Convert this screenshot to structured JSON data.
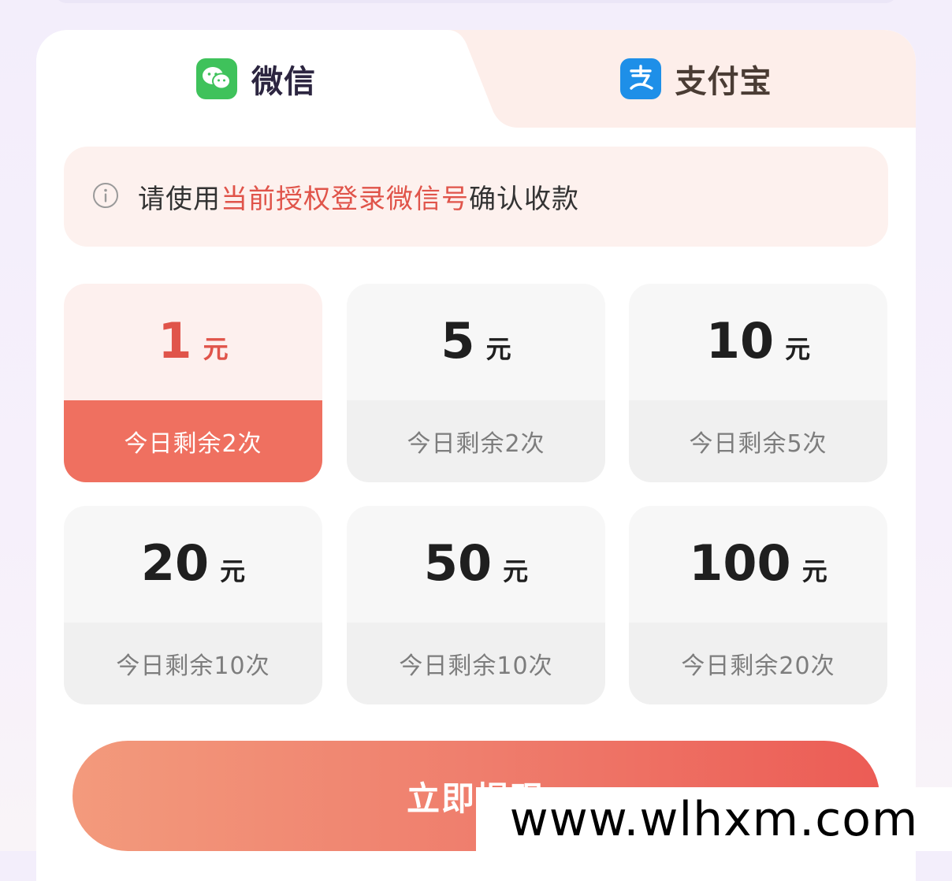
{
  "tabs": {
    "wechat": {
      "label": "微信",
      "icon": "wechat-icon",
      "active": true
    },
    "alipay": {
      "label": "支付宝",
      "icon": "alipay-icon",
      "active": false
    }
  },
  "notice": {
    "icon": "info-icon",
    "prefix": "请使用",
    "highlight": "当前授权登录微信号",
    "suffix": "确认收款"
  },
  "options": [
    {
      "amount": "1",
      "unit": "元",
      "remaining": "今日剩余2次",
      "selected": true
    },
    {
      "amount": "5",
      "unit": "元",
      "remaining": "今日剩余2次",
      "selected": false
    },
    {
      "amount": "10",
      "unit": "元",
      "remaining": "今日剩余5次",
      "selected": false
    },
    {
      "amount": "20",
      "unit": "元",
      "remaining": "今日剩余10次",
      "selected": false
    },
    {
      "amount": "50",
      "unit": "元",
      "remaining": "今日剩余10次",
      "selected": false
    },
    {
      "amount": "100",
      "unit": "元",
      "remaining": "今日剩余20次",
      "selected": false
    }
  ],
  "withdraw_button": {
    "label": "立即提现"
  },
  "watermark": "www.wlhxm.com",
  "colors": {
    "accent": "#e0544a",
    "selected_badge": "#ef7060",
    "wechat_green": "#3fc25b",
    "alipay_blue": "#1e8fe8"
  }
}
